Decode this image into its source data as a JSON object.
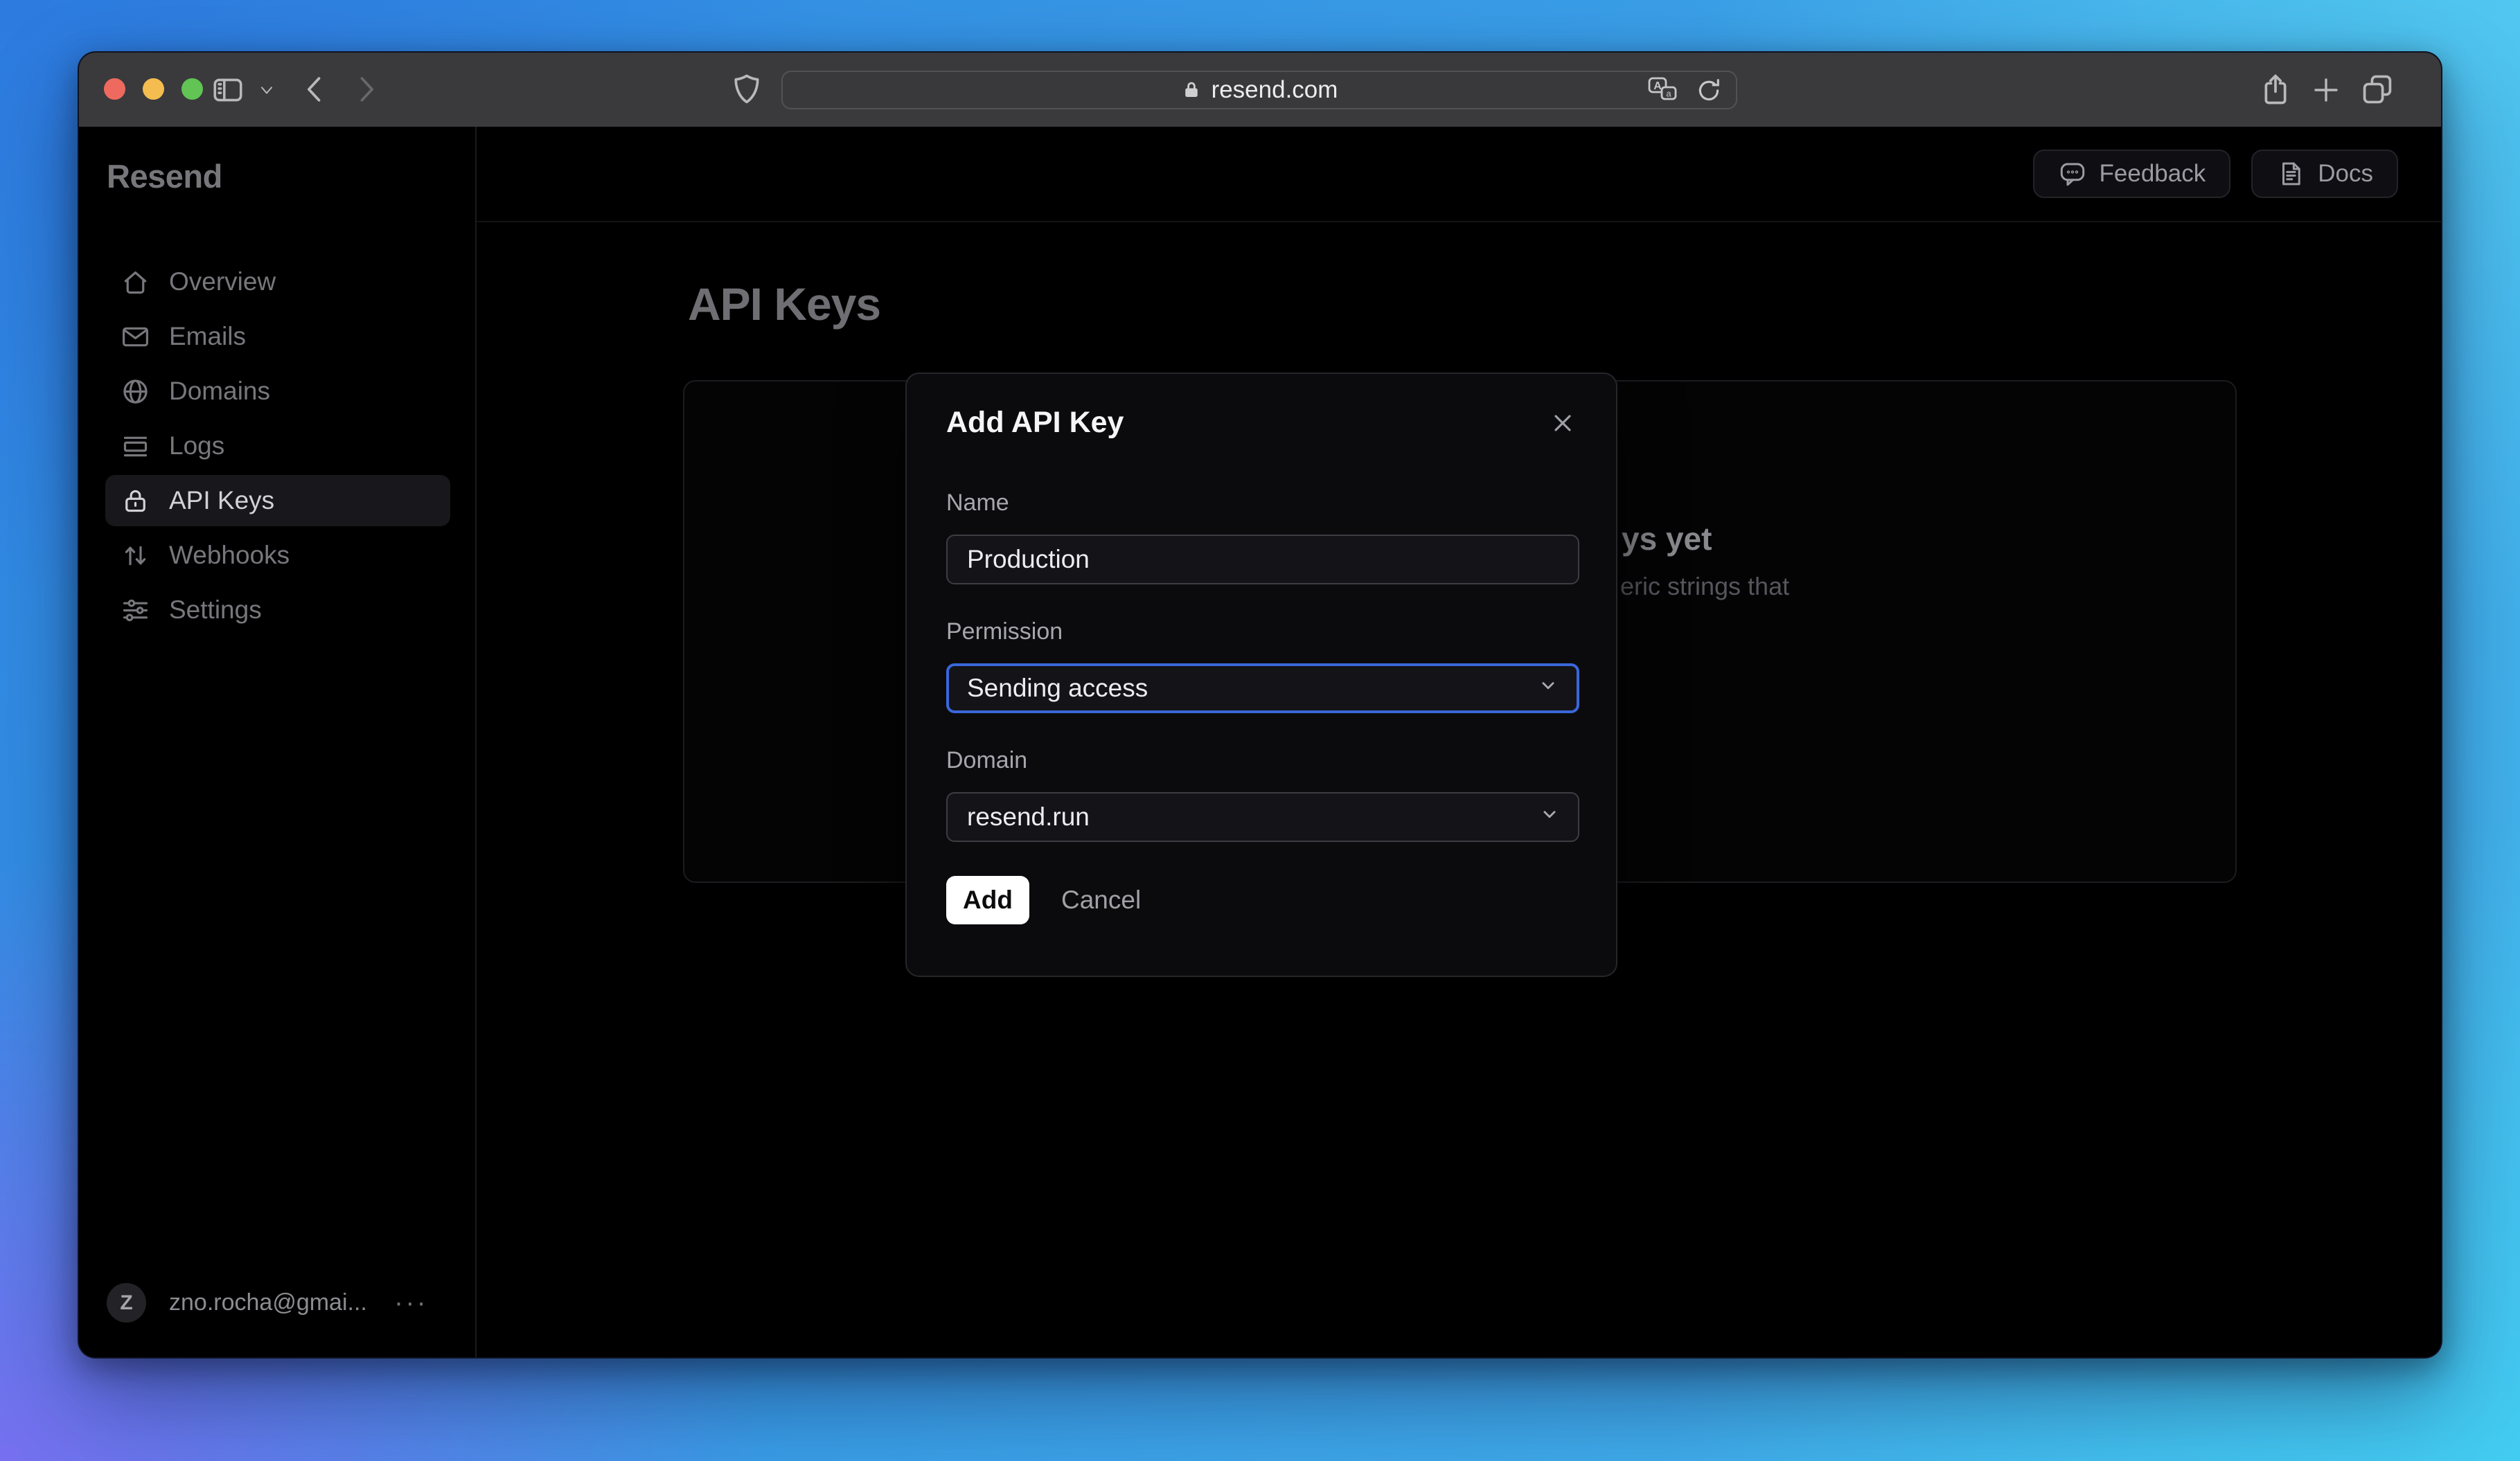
{
  "browser": {
    "url": "resend.com",
    "traffic_lights": {
      "close": "#ee6a5f",
      "minimize": "#f5bd4f",
      "zoom": "#61c454"
    }
  },
  "sidebar": {
    "logo": "Resend",
    "items": [
      {
        "label": "Overview",
        "icon": "home-icon",
        "active": false
      },
      {
        "label": "Emails",
        "icon": "envelope-icon",
        "active": false
      },
      {
        "label": "Domains",
        "icon": "globe-icon",
        "active": false
      },
      {
        "label": "Logs",
        "icon": "logs-icon",
        "active": false
      },
      {
        "label": "API Keys",
        "icon": "lock-icon",
        "active": true
      },
      {
        "label": "Webhooks",
        "icon": "arrows-up-down-icon",
        "active": false
      },
      {
        "label": "Settings",
        "icon": "sliders-icon",
        "active": false
      }
    ],
    "account": {
      "initial": "Z",
      "email": "zno.rocha@gmai...",
      "menu": "···"
    }
  },
  "header": {
    "feedback": "Feedback",
    "docs": "Docs"
  },
  "page": {
    "title": "API Keys",
    "empty_state": {
      "heading_fragment": "ys yet",
      "body_fragment": "eric strings that"
    }
  },
  "modal": {
    "title": "Add API Key",
    "fields": {
      "name": {
        "label": "Name",
        "value": "Production"
      },
      "permission": {
        "label": "Permission",
        "value": "Sending access"
      },
      "domain": {
        "label": "Domain",
        "value": "resend.run"
      }
    },
    "buttons": {
      "add": "Add",
      "cancel": "Cancel"
    }
  },
  "colors": {
    "focus_ring": "#3a67da",
    "add_button_bg": "#ffffff",
    "wallpaper_top_left": "#2e7cdf",
    "wallpaper_bottom_left": "#7b6ef0",
    "wallpaper_right": "#45cdf2",
    "toolbar": "#3a3a3d",
    "window_bg": "#000000",
    "modal_bg": "#0b0b0e"
  }
}
